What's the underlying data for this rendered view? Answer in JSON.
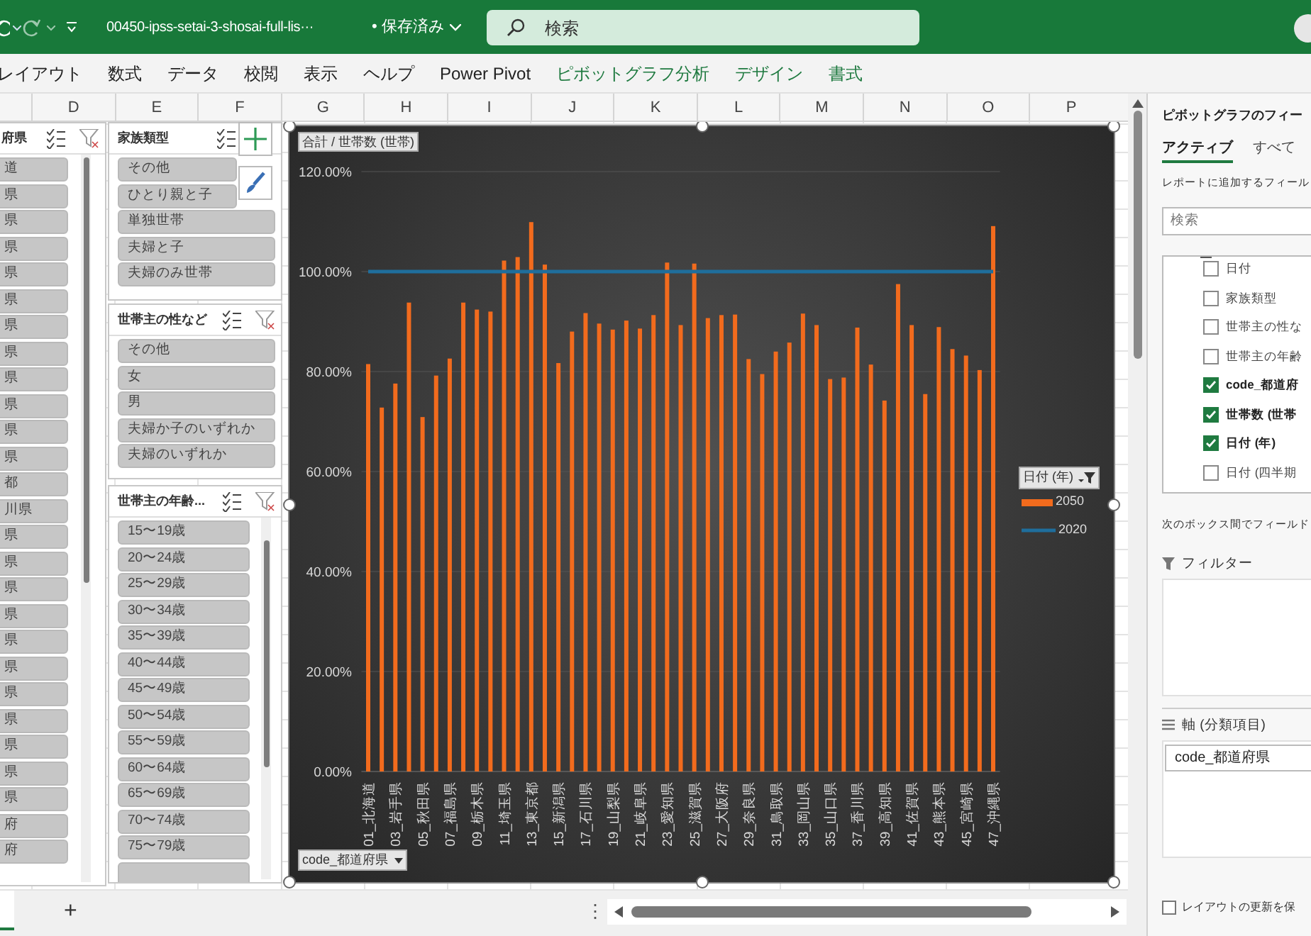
{
  "title_bar": {
    "file_name": "00450-ipss-setai-3-shosai-full-lis···",
    "save_status": "• 保存済み",
    "search": {
      "placeholder": "検索"
    }
  },
  "ribbon_tabs": [
    {
      "label": "レイアウト",
      "kind": "standard"
    },
    {
      "label": "数式",
      "kind": "standard"
    },
    {
      "label": "データ",
      "kind": "standard"
    },
    {
      "label": "校閲",
      "kind": "standard"
    },
    {
      "label": "表示",
      "kind": "standard"
    },
    {
      "label": "ヘルプ",
      "kind": "standard"
    },
    {
      "label": "Power Pivot",
      "kind": "standard"
    },
    {
      "label": "ピボットグラフ分析",
      "kind": "contextual"
    },
    {
      "label": "デザイン",
      "kind": "contextual"
    },
    {
      "label": "書式",
      "kind": "contextual"
    }
  ],
  "column_headers": [
    "D",
    "E",
    "F",
    "G",
    "H",
    "I",
    "J",
    "K",
    "L",
    "M",
    "N",
    "O",
    "P"
  ],
  "slicers": [
    {
      "title": "府県",
      "items": [
        "道",
        "県",
        "県",
        "県",
        "県",
        "県",
        "県",
        "県",
        "県",
        "県",
        "県",
        "県",
        "都",
        "川県",
        "県",
        "県",
        "県",
        "県",
        "県",
        "県",
        "県",
        "県",
        "県",
        "県",
        "県",
        "府",
        "府"
      ]
    },
    {
      "title": "家族類型",
      "items": [
        "その他",
        "ひとり親と子",
        "単独世帯",
        "夫婦と子",
        "夫婦のみ世帯"
      ]
    },
    {
      "title": "世帯主の性など",
      "items": [
        "その他",
        "女",
        "男",
        "夫婦か子のいずれか",
        "夫婦のいずれか"
      ]
    },
    {
      "title": "世帯主の年齢...",
      "items": [
        "15〜19歳",
        "20〜24歳",
        "25〜29歳",
        "30〜34歳",
        "35〜39歳",
        "40〜44歳",
        "45〜49歳",
        "50〜54歳",
        "55〜59歳",
        "60〜64歳",
        "65〜69歳",
        "70〜74歳",
        "75〜79歳"
      ]
    }
  ],
  "chart": {
    "value_field_button": "合計 / 世帯数 (世帯)",
    "axis_field_button": "code_都道府県",
    "legend_field_button": "日付 (年)",
    "chart_data": {
      "type": "bar",
      "x": [
        1,
        2,
        3,
        4,
        5,
        6,
        7,
        8,
        9,
        10,
        11,
        12,
        13,
        14,
        15,
        16,
        17,
        18,
        19,
        20,
        21,
        22,
        23,
        24,
        25,
        26,
        27,
        28,
        29,
        30,
        31,
        32,
        33,
        34,
        35,
        36,
        37,
        38,
        39,
        40,
        41,
        42,
        43,
        44,
        45,
        46,
        47
      ],
      "xticks": [
        {
          "value": 1,
          "label": "01_北海道"
        },
        {
          "value": 3,
          "label": "03_岩手県"
        },
        {
          "value": 5,
          "label": "05_秋田県"
        },
        {
          "value": 7,
          "label": "07_福島県"
        },
        {
          "value": 9,
          "label": "09_栃木県"
        },
        {
          "value": 11,
          "label": "11_埼玉県"
        },
        {
          "value": 13,
          "label": "13_東京都"
        },
        {
          "value": 15,
          "label": "15_新潟県"
        },
        {
          "value": 17,
          "label": "17_石川県"
        },
        {
          "value": 19,
          "label": "19_山梨県"
        },
        {
          "value": 21,
          "label": "21_岐阜県"
        },
        {
          "value": 23,
          "label": "23_愛知県"
        },
        {
          "value": 25,
          "label": "25_滋賀県"
        },
        {
          "value": 27,
          "label": "27_大阪府"
        },
        {
          "value": 29,
          "label": "29_奈良県"
        },
        {
          "value": 31,
          "label": "31_鳥取県"
        },
        {
          "value": 33,
          "label": "33_岡山県"
        },
        {
          "value": 35,
          "label": "35_山口県"
        },
        {
          "value": 37,
          "label": "37_香川県"
        },
        {
          "value": 39,
          "label": "39_高知県"
        },
        {
          "value": 41,
          "label": "41_佐賀県"
        },
        {
          "value": 43,
          "label": "43_熊本県"
        },
        {
          "value": 45,
          "label": "45_宮崎県"
        },
        {
          "value": 47,
          "label": "47_沖縄県"
        }
      ],
      "grid": true,
      "legend": "right",
      "xlim": [
        0.5,
        47.5
      ],
      "ylim": [
        0,
        120
      ],
      "yticks": [
        {
          "value": 0,
          "label": "0.00%"
        },
        {
          "value": 20,
          "label": "20.00%"
        },
        {
          "value": 40,
          "label": "40.00%"
        },
        {
          "value": 60,
          "label": "60.00%"
        },
        {
          "value": 80,
          "label": "80.00%"
        },
        {
          "value": 100,
          "label": "100.00%"
        },
        {
          "value": 120,
          "label": "120.00%"
        }
      ],
      "series": [
        {
          "name": "2050",
          "color": "#f26b1d",
          "values": [
            81.5,
            72.8,
            77.6,
            93.8,
            70.9,
            79.2,
            82.6,
            93.8,
            92.4,
            92.0,
            102.2,
            102.9,
            109.9,
            101.4,
            81.7,
            88.0,
            91.7,
            89.6,
            88.4,
            90.2,
            88.6,
            91.3,
            101.8,
            89.3,
            101.6,
            90.7,
            91.3,
            91.4,
            82.5,
            79.5,
            84.0,
            85.8,
            91.6,
            89.3,
            78.5,
            78.8,
            88.8,
            81.4,
            74.2,
            97.5,
            89.3,
            75.5,
            88.9,
            84.5,
            83.2,
            80.3,
            109.1
          ]
        },
        {
          "name": "2020",
          "type": "line",
          "color": "#1f6e9c",
          "values": [
            100,
            100,
            100,
            100,
            100,
            100,
            100,
            100,
            100,
            100,
            100,
            100,
            100,
            100,
            100,
            100,
            100,
            100,
            100,
            100,
            100,
            100,
            100,
            100,
            100,
            100,
            100,
            100,
            100,
            100,
            100,
            100,
            100,
            100,
            100,
            100,
            100,
            100,
            100,
            100,
            100,
            100,
            100,
            100,
            100,
            100,
            100
          ]
        }
      ]
    }
  },
  "sheet_bar": {
    "new_sheet": "+",
    "options": "⋮"
  },
  "field_pane": {
    "title": "ピボットグラフのフィー",
    "tabs": [
      {
        "label": "アクティブ",
        "selected": true
      },
      {
        "label": "すべて",
        "selected": false
      }
    ],
    "hint": "レポートに追加するフィール",
    "search": {
      "placeholder": "検索"
    },
    "fields": [
      {
        "label": "日付",
        "checked": false
      },
      {
        "label": "家族類型",
        "checked": false
      },
      {
        "label": "世帯主の性な",
        "checked": false
      },
      {
        "label": "世帯主の年齢",
        "checked": false
      },
      {
        "label": "code_都道府",
        "checked": true
      },
      {
        "label": "世帯数 (世帯",
        "checked": true
      },
      {
        "label": "日付 (年)",
        "checked": true
      },
      {
        "label": "日付 (四半期",
        "checked": false
      }
    ],
    "areas_hint": "次のボックス間でフィールド",
    "areas": [
      {
        "label": "フィルター",
        "kind": "filter"
      },
      {
        "label": "軸 (分類項目)",
        "kind": "axis",
        "items": [
          "code_都道府県"
        ]
      }
    ],
    "defer_update": {
      "label": "レイアウトの更新を保",
      "checked": false
    }
  }
}
